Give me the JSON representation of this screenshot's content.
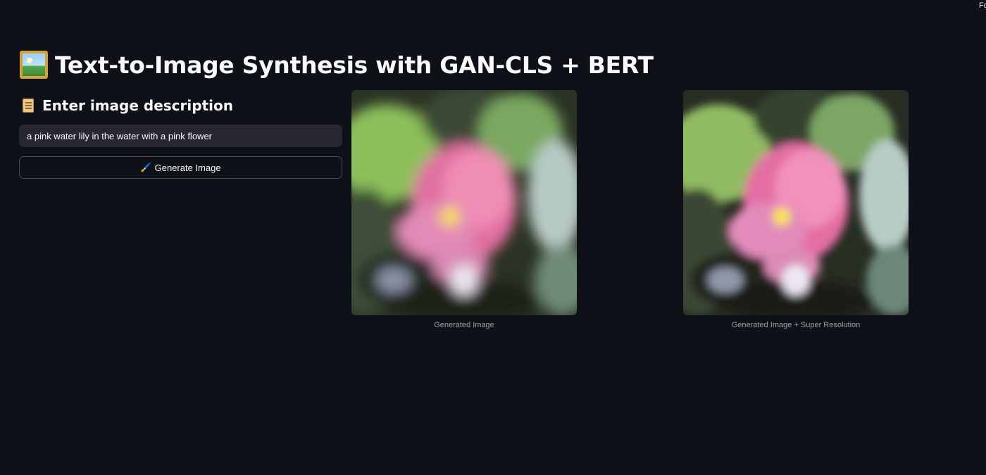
{
  "corner_text": "Fo",
  "title": "Text-to-Image Synthesis with GAN-CLS + BERT",
  "title_icon": "framed-picture-icon",
  "subheader": "Enter image description",
  "subheader_icon": "scroll-icon",
  "input": {
    "value": "a pink water lily in the water with a pink flower"
  },
  "button": {
    "label": "Generate Image",
    "icon": "paintbrush-icon"
  },
  "images": [
    {
      "caption": "Generated Image"
    },
    {
      "caption": "Generated Image + Super Resolution"
    }
  ],
  "colors": {
    "background": "#0e1117",
    "input_bg": "#262730",
    "text": "#fafafa"
  }
}
